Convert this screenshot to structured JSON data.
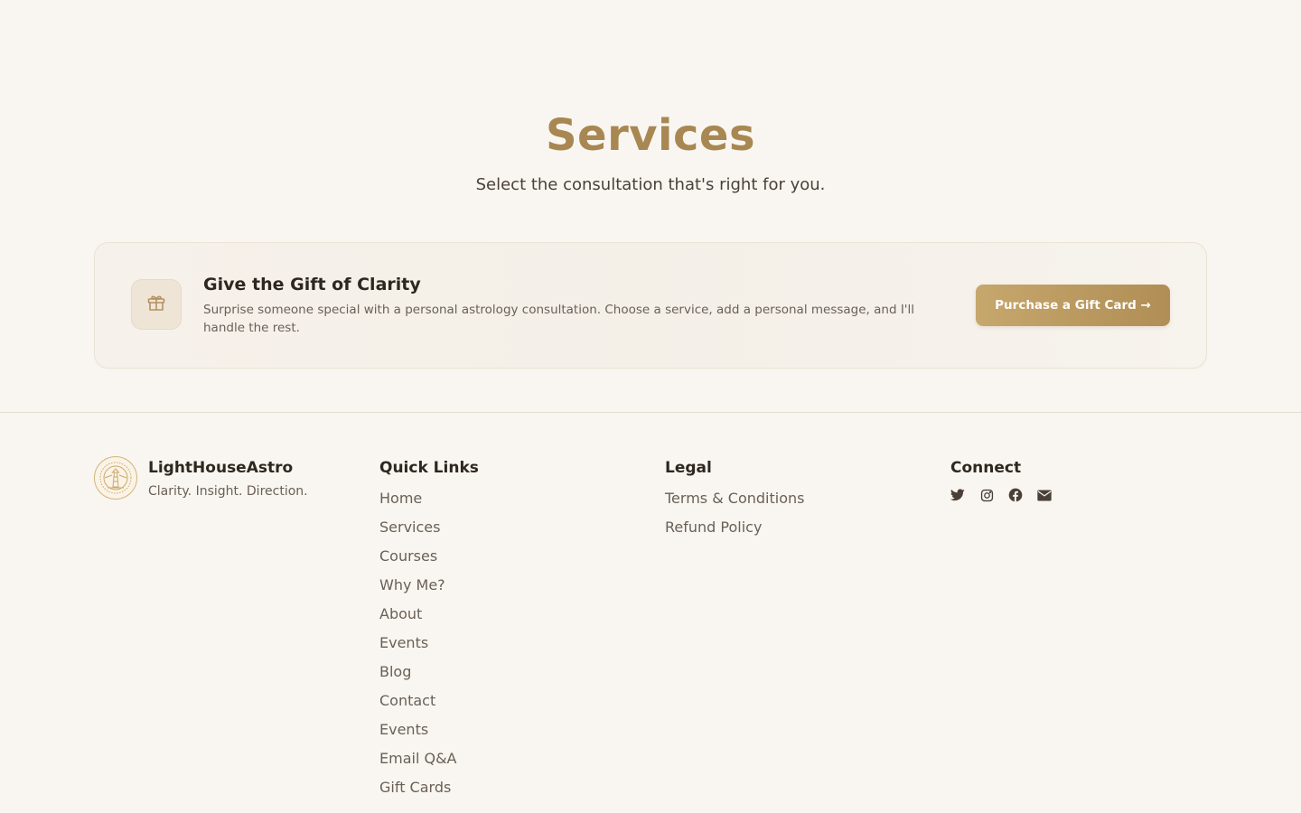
{
  "hero": {
    "title": "Services",
    "subtitle": "Select the consultation that's right for you."
  },
  "gift": {
    "icon": "gift-icon",
    "title": "Give the Gift of Clarity",
    "description": "Surprise someone special with a personal astrology consultation. Choose a service, add a personal message, and I'll handle the rest.",
    "button_label": "Purchase a Gift Card →"
  },
  "footer": {
    "brand": {
      "name": "LightHouseAstro",
      "tagline": "Clarity. Insight. Direction.",
      "logo_icon": "lighthouse-logo-icon"
    },
    "quick_links": {
      "heading": "Quick Links",
      "items": [
        "Home",
        "Services",
        "Courses",
        "Why Me?",
        "About",
        "Events",
        "Blog",
        "Contact",
        "Events",
        "Email Q&A",
        "Gift Cards"
      ]
    },
    "legal": {
      "heading": "Legal",
      "items": [
        "Terms & Conditions",
        "Refund Policy"
      ]
    },
    "connect": {
      "heading": "Connect",
      "icons": [
        "twitter-icon",
        "instagram-icon",
        "facebook-icon",
        "email-icon"
      ]
    }
  },
  "colors": {
    "background": "#f9f6f1",
    "accent": "#a88752",
    "button_gradient_start": "#c6a76c",
    "button_gradient_end": "#b08e55",
    "heading_text": "#2e2720",
    "muted_text": "#6a6057"
  }
}
